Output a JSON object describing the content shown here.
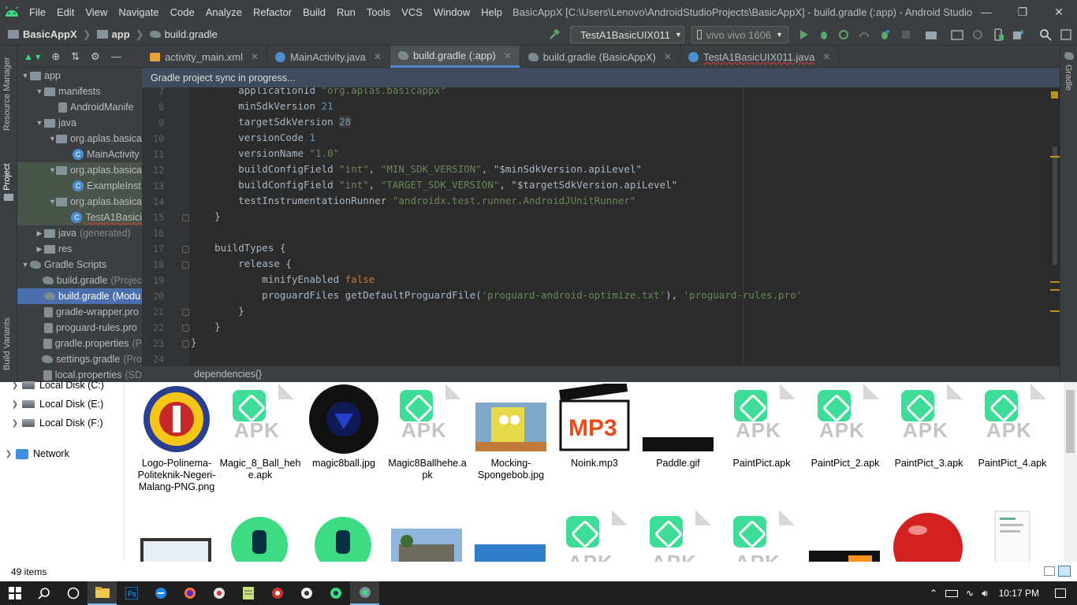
{
  "app": {
    "title": "BasicAppX [C:\\Users\\Lenovo\\AndroidStudioProjects\\BasicAppX] - build.gradle (:app) - Android Studio",
    "menu": [
      "File",
      "Edit",
      "View",
      "Navigate",
      "Code",
      "Analyze",
      "Refactor",
      "Build",
      "Run",
      "Tools",
      "VCS",
      "Window",
      "Help"
    ]
  },
  "navbar": {
    "crumbs": [
      "BasicAppX",
      "app",
      "build.gradle"
    ],
    "run_config": "TestA1BasicUIX011",
    "device": "vivo vivo 1606"
  },
  "side_tools": {
    "left": [
      "Resource Manager",
      "1: Project",
      "Build Variants"
    ],
    "right": [
      "Gradle"
    ]
  },
  "project_tree": [
    {
      "label": "app",
      "indent": 0,
      "arrow": "down",
      "icon": "folder"
    },
    {
      "label": "manifests",
      "indent": 1,
      "arrow": "down",
      "icon": "folder"
    },
    {
      "label": "AndroidManife",
      "indent": 2,
      "arrow": "",
      "icon": "props"
    },
    {
      "label": "java",
      "indent": 1,
      "arrow": "down",
      "icon": "folder"
    },
    {
      "label": "org.aplas.basica",
      "indent": 2,
      "arrow": "down",
      "icon": "folder"
    },
    {
      "label": "MainActivity",
      "indent": 3,
      "arrow": "",
      "icon": "class"
    },
    {
      "label": "org.aplas.basica",
      "indent": 2,
      "arrow": "down",
      "icon": "folder",
      "test": true
    },
    {
      "label": "ExampleInst",
      "indent": 3,
      "arrow": "",
      "icon": "class",
      "test": true
    },
    {
      "label": "org.aplas.basica",
      "indent": 2,
      "arrow": "down",
      "icon": "folder",
      "test": true
    },
    {
      "label": "TestA1Basici",
      "indent": 3,
      "arrow": "",
      "icon": "class",
      "test": true,
      "error": true
    },
    {
      "label": "java",
      "dim": "(generated)",
      "indent": 1,
      "arrow": "right",
      "icon": "folder"
    },
    {
      "label": "res",
      "indent": 1,
      "arrow": "right",
      "icon": "folder"
    },
    {
      "label": "Gradle Scripts",
      "indent": 0,
      "arrow": "down",
      "icon": "gradle"
    },
    {
      "label": "build.gradle",
      "dim": "(Projec",
      "indent": 1,
      "arrow": "",
      "icon": "gradle"
    },
    {
      "label": "build.gradle",
      "dim": "(Modu",
      "indent": 1,
      "arrow": "",
      "icon": "gradle",
      "selected": true
    },
    {
      "label": "gradle-wrapper.pro",
      "indent": 1,
      "arrow": "",
      "icon": "props"
    },
    {
      "label": "proguard-rules.pro",
      "indent": 1,
      "arrow": "",
      "icon": "props"
    },
    {
      "label": "gradle.properties",
      "dim": "(P",
      "indent": 1,
      "arrow": "",
      "icon": "props"
    },
    {
      "label": "settings.gradle",
      "dim": "(Pro",
      "indent": 1,
      "arrow": "",
      "icon": "gradle"
    },
    {
      "label": "local.properties",
      "dim": "(SD",
      "indent": 1,
      "arrow": "",
      "icon": "props"
    }
  ],
  "tabs": [
    {
      "label": "activity_main.xml",
      "icon": "xml"
    },
    {
      "label": "MainActivity.java",
      "icon": "class"
    },
    {
      "label": "build.gradle (:app)",
      "icon": "gradle",
      "active": true
    },
    {
      "label": "build.gradle (BasicAppX)",
      "icon": "gradle"
    },
    {
      "label": "TestA1BasicUIX011.java",
      "icon": "class",
      "error": true
    }
  ],
  "banner": "Gradle project sync in progress...",
  "code_lines": [
    {
      "n": "7",
      "html": "        applicationId <span class=\"str\">\"org.aplas.basicappx\"</span>"
    },
    {
      "n": "8",
      "html": "        minSdkVersion <span class=\"num\">21</span>"
    },
    {
      "n": "9",
      "html": "        targetSdkVersion <span class=\"num hl\">28</span>"
    },
    {
      "n": "10",
      "html": "        versionCode <span class=\"num\">1</span>"
    },
    {
      "n": "11",
      "html": "        versionName <span class=\"str\">\"1.0\"</span>"
    },
    {
      "n": "12",
      "html": "        buildConfigField <span class=\"str\">\"int\"</span>, <span class=\"str\">\"MIN_SDK_VERSION\"</span>, \"$minSdkVersion.apiLevel\""
    },
    {
      "n": "13",
      "html": "        buildConfigField <span class=\"str\">\"int\"</span>, <span class=\"str\">\"TARGET_SDK_VERSION\"</span>, \"$targetSdkVersion.apiLevel\""
    },
    {
      "n": "14",
      "html": "        testInstrumentationRunner <span class=\"str\">\"androidx.test.runner.AndroidJUnitRunner\"</span>"
    },
    {
      "n": "15",
      "html": "    }"
    },
    {
      "n": "16",
      "html": ""
    },
    {
      "n": "17",
      "html": "    buildTypes {"
    },
    {
      "n": "18",
      "html": "        release {"
    },
    {
      "n": "19",
      "html": "            minifyEnabled <span class=\"kw\">false</span>"
    },
    {
      "n": "20",
      "html": "            proguardFiles getDefaultProguardFile(<span class=\"str\">'proguard-android-optimize.txt'</span>), <span class=\"str\">'proguard-rules.pro'</span>"
    },
    {
      "n": "21",
      "html": "        }"
    },
    {
      "n": "22",
      "html": "    }"
    },
    {
      "n": "23",
      "html": "}"
    },
    {
      "n": "24",
      "html": ""
    }
  ],
  "editor_breadcrumb": "dependencies{}",
  "explorer": {
    "nav": [
      {
        "label": "Local Disk (C:)",
        "type": "disk"
      },
      {
        "label": "Local Disk (E:)",
        "type": "disk"
      },
      {
        "label": "Local Disk (F:)",
        "type": "disk"
      },
      {
        "label": "Network",
        "type": "network"
      }
    ],
    "files_row1": [
      {
        "name": "Logo-Polinema-Politeknik-Negeri-Malang-PNG.png",
        "kind": "logo"
      },
      {
        "name": "Magic_8_Ball_hehe.apk",
        "kind": "apk"
      },
      {
        "name": "magic8ball.jpg",
        "kind": "ball"
      },
      {
        "name": "Magic8Ballhehe.apk",
        "kind": "apk"
      },
      {
        "name": "Mocking-Spongebob.jpg",
        "kind": "sponge"
      },
      {
        "name": "Noink.mp3",
        "kind": "mp3"
      },
      {
        "name": "Paddle.gif",
        "kind": "paddle"
      },
      {
        "name": "PaintPict.apk",
        "kind": "apk"
      },
      {
        "name": "PaintPict_2.apk",
        "kind": "apk"
      },
      {
        "name": "PaintPict_3.apk",
        "kind": "apk"
      },
      {
        "name": "PaintPict_4.apk",
        "kind": "apk"
      }
    ],
    "status": "49 items"
  },
  "taskbar": {
    "time": "10:17 PM"
  },
  "colors": {
    "accent": "#4a88c7",
    "selection": "#4b6eaf",
    "apk_green": "#3ddc97"
  }
}
